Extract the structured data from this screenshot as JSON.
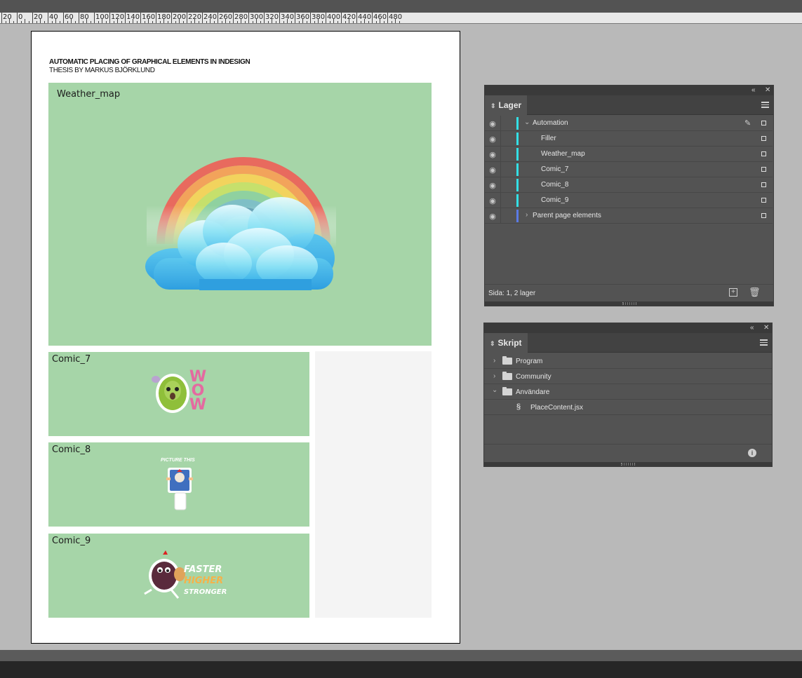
{
  "ruler": {
    "labels": [
      "20",
      "0",
      "20",
      "40",
      "60",
      "80",
      "100",
      "120",
      "140",
      "160",
      "180",
      "200",
      "220",
      "240",
      "260",
      "280",
      "300",
      "320",
      "340",
      "360",
      "380",
      "400",
      "420",
      "440",
      "460",
      "480"
    ]
  },
  "document": {
    "title": "AUTOMATIC PLACING OF GRAPHICAL ELEMENTS IN INDESIGN",
    "subtitle": "THESIS BY MARKUS BJÖRKLUND",
    "frames": {
      "weather": "Weather_map",
      "comic7": "Comic_7",
      "comic8": "Comic_8",
      "comic9": "Comic_9"
    },
    "comic7_text": "WOW",
    "comic8_text": "PICTURE THIS",
    "comic9_lines": [
      "FASTER",
      "HIGHER",
      "STRONGER"
    ]
  },
  "layers_panel": {
    "tab": "Lager",
    "rows": [
      {
        "name": "Automation",
        "toggle": "⌄"
      },
      {
        "name": "Filler"
      },
      {
        "name": "Weather_map"
      },
      {
        "name": "Comic_7"
      },
      {
        "name": "Comic_8"
      },
      {
        "name": "Comic_9"
      },
      {
        "name": "Parent page elements",
        "toggle": "›"
      }
    ],
    "status": "Sida: 1, 2 lager"
  },
  "scripts_panel": {
    "tab": "Skript",
    "rows": [
      {
        "name": "Program",
        "toggle": "›"
      },
      {
        "name": "Community",
        "toggle": "›"
      },
      {
        "name": "Användare",
        "toggle": "⌄"
      },
      {
        "name": "PlaceContent.jsx"
      }
    ]
  },
  "colors": {
    "frame_green": "#a6d5a8",
    "layer_cyan": "#33e0e6",
    "layer_blue": "#5b7be6"
  }
}
